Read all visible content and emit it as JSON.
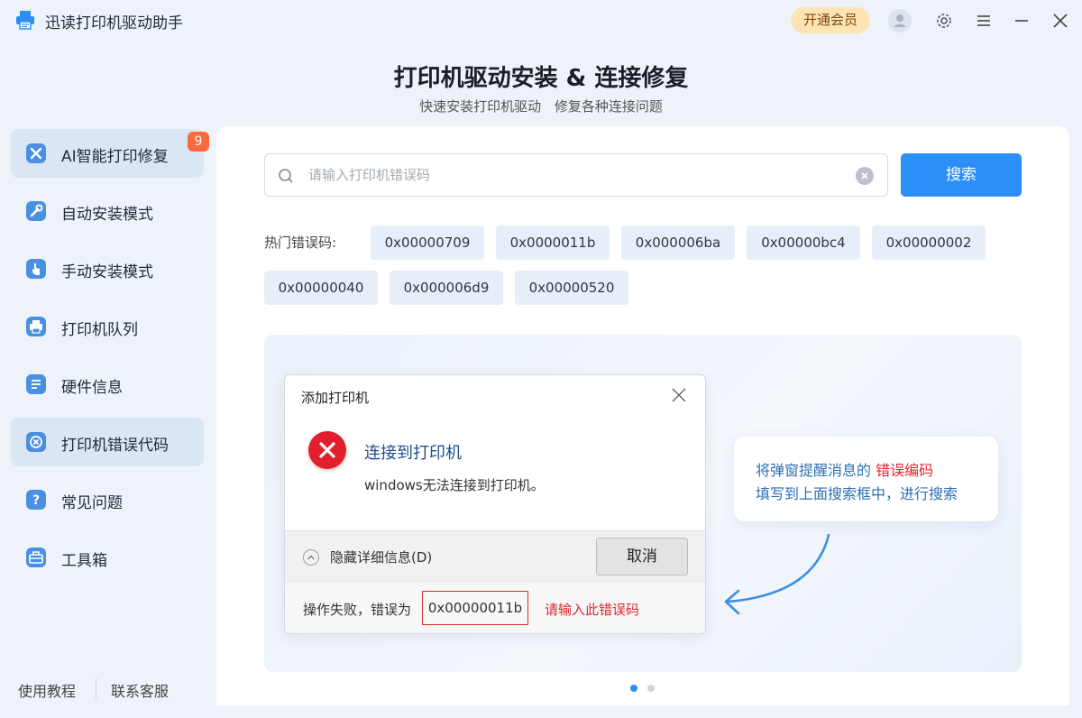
{
  "app": {
    "title": "迅读打印机驱动助手",
    "vip_label": "开通会员"
  },
  "header": {
    "title": "打印机驱动安装 & 连接修复",
    "subtitle": "快速安装打印机驱动 修复各种连接问题"
  },
  "sidebar": {
    "items": [
      {
        "label": "AI智能打印修复",
        "icon": "wrench-screwdriver-icon",
        "badge": "9",
        "active": true
      },
      {
        "label": "自动安装模式",
        "icon": "wrench-icon"
      },
      {
        "label": "手动安装模式",
        "icon": "hand-pointer-icon"
      },
      {
        "label": "打印机队列",
        "icon": "printer-icon"
      },
      {
        "label": "硬件信息",
        "icon": "document-list-icon"
      },
      {
        "label": "打印机错误代码",
        "icon": "error-x-icon",
        "active": true
      },
      {
        "label": "常见问题",
        "icon": "question-icon"
      },
      {
        "label": "工具箱",
        "icon": "toolbox-icon"
      }
    ],
    "footer": {
      "tutorial": "使用教程",
      "support": "联系客服"
    }
  },
  "search": {
    "placeholder": "请输入打印机错误码",
    "value": "",
    "button_label": "搜索"
  },
  "hot_codes": {
    "label": "热门错误码:",
    "codes": [
      "0x00000709",
      "0x0000011b",
      "0x000006ba",
      "0x00000bc4",
      "0x00000002",
      "0x00000040",
      "0x000006d9",
      "0x00000520"
    ]
  },
  "illustration": {
    "dialog": {
      "title": "添加打印机",
      "heading": "连接到打印机",
      "message": "windows无法连接到打印机。",
      "details_toggle": "隐藏详细信息(D)",
      "cancel": "取消",
      "fail_text": "操作失败，错误为",
      "error_code": "0x00000011b",
      "hint": "请输入此错误码"
    },
    "tip": {
      "line1_prefix": "将弹窗提醒消息的",
      "line1_highlight": "错误编码",
      "line2": "填写到上面搜索框中，进行搜索"
    }
  },
  "carousel": {
    "count": 2,
    "active": 1
  },
  "colors": {
    "accent": "#2b8ff8",
    "error": "#e0282c",
    "badge": "#ff6a3d"
  }
}
